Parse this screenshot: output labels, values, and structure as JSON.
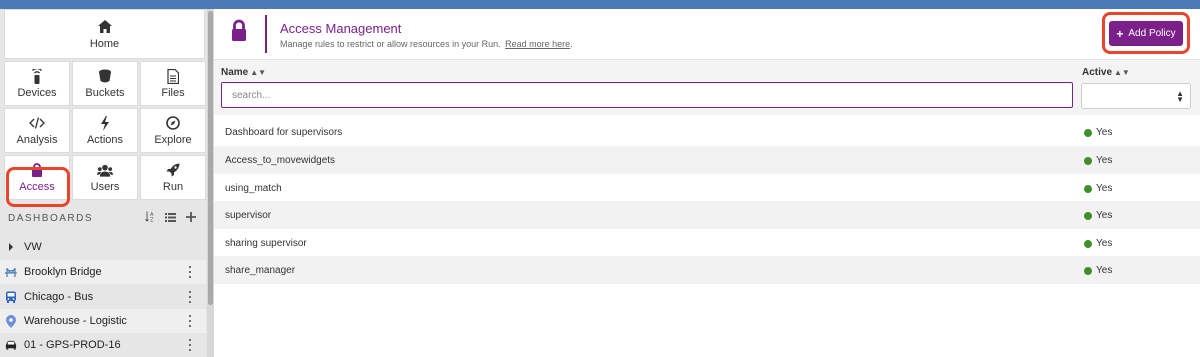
{
  "sidebar": {
    "nav": {
      "home": {
        "label": "Home",
        "icon": "home-icon"
      },
      "devices": {
        "label": "Devices",
        "icon": "device-icon"
      },
      "buckets": {
        "label": "Buckets",
        "icon": "bucket-icon"
      },
      "files": {
        "label": "Files",
        "icon": "file-icon"
      },
      "analysis": {
        "label": "Analysis",
        "icon": "code-icon"
      },
      "actions": {
        "label": "Actions",
        "icon": "bolt-icon"
      },
      "explore": {
        "label": "Explore",
        "icon": "compass-icon"
      },
      "access": {
        "label": "Access",
        "icon": "lock-icon"
      },
      "users": {
        "label": "Users",
        "icon": "users-icon"
      },
      "run": {
        "label": "Run",
        "icon": "rocket-icon"
      }
    },
    "dashboards": {
      "title": "DASHBOARDS",
      "items": [
        {
          "label": "VW",
          "icon": "caret-right-icon"
        },
        {
          "label": "Brooklyn Bridge",
          "icon": "bridge-icon"
        },
        {
          "label": "Chicago - Bus",
          "icon": "bus-icon"
        },
        {
          "label": "Warehouse - Logistic",
          "icon": "map-marker-icon"
        },
        {
          "label": "01 - GPS-PROD-16",
          "icon": "car-icon"
        }
      ]
    }
  },
  "header": {
    "title": "Access Management",
    "subtitle": "Manage rules to restrict or allow resources in your Run.",
    "link_label": "Read more here",
    "link_suffix": ".",
    "add_button_label": "Add Policy",
    "accent_color": "#7b1f8a",
    "highlight_color": "#e8452c"
  },
  "table": {
    "columns": {
      "name": "Name",
      "active": "Active"
    },
    "search_placeholder": "search...",
    "rows": [
      {
        "name": "Dashboard for supervisors",
        "active": "Yes"
      },
      {
        "name": "Access_to_movewidgets",
        "active": "Yes"
      },
      {
        "name": "using_match",
        "active": "Yes"
      },
      {
        "name": "supervisor",
        "active": "Yes"
      },
      {
        "name": "sharing supervisor",
        "active": "Yes"
      },
      {
        "name": "share_manager",
        "active": "Yes"
      }
    ],
    "status_color": "#3f8f2b"
  }
}
